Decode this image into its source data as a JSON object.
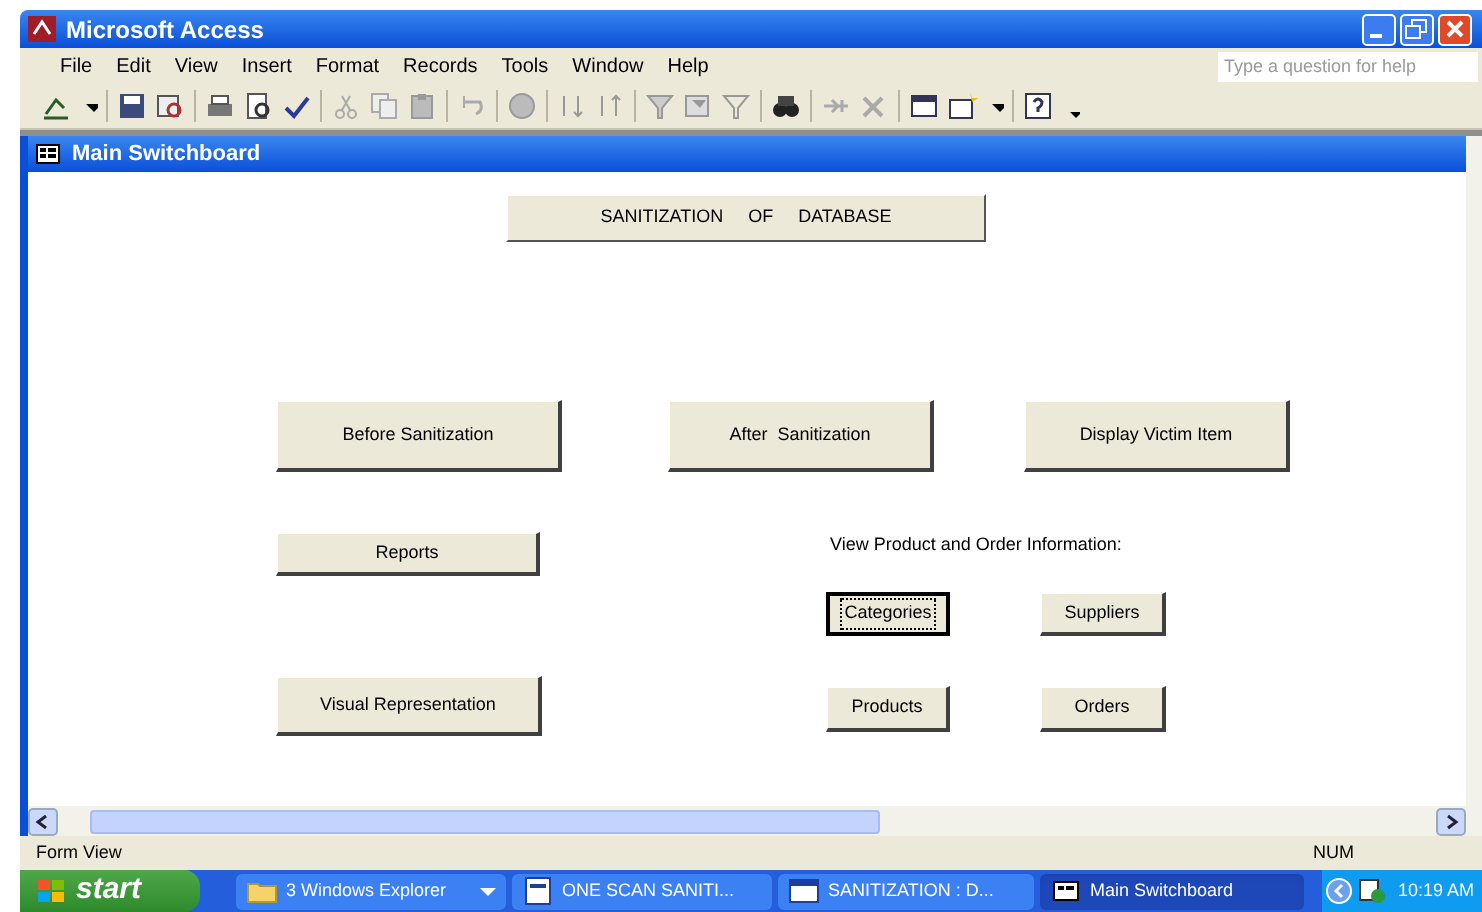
{
  "window": {
    "title": "Microsoft Access"
  },
  "menu": [
    "File",
    "Edit",
    "View",
    "Insert",
    "Format",
    "Records",
    "Tools",
    "Window",
    "Help"
  ],
  "help_search": {
    "placeholder": "Type a question for help"
  },
  "form": {
    "title": "Main Switchboard",
    "heading": "SANITIZATION     OF     DATABASE",
    "caption": "View Product and Order Information:",
    "buttons": [
      {
        "label": "Before Sanitization",
        "focused": false
      },
      {
        "label": "After  Sanitization",
        "focused": false
      },
      {
        "label": "Display Victim Item",
        "focused": false
      },
      {
        "label": "Reports",
        "focused": false
      },
      {
        "label": "Categories",
        "focused": true
      },
      {
        "label": "Suppliers",
        "focused": false
      },
      {
        "label": "Visual Representation",
        "focused": false
      },
      {
        "label": "Products",
        "focused": false
      },
      {
        "label": "Orders",
        "focused": false
      }
    ]
  },
  "status_bar": {
    "mode": "Form View",
    "indicator": "NUM"
  },
  "taskbar": {
    "start": "start",
    "tasks": [
      {
        "label": "3 Windows Explorer",
        "selected": false
      },
      {
        "label": "ONE SCAN SANITI...",
        "selected": false
      },
      {
        "label": "SANITIZATION : D...",
        "selected": false
      },
      {
        "label": "Main Switchboard",
        "selected": true
      }
    ],
    "clock": "10:19 AM"
  }
}
